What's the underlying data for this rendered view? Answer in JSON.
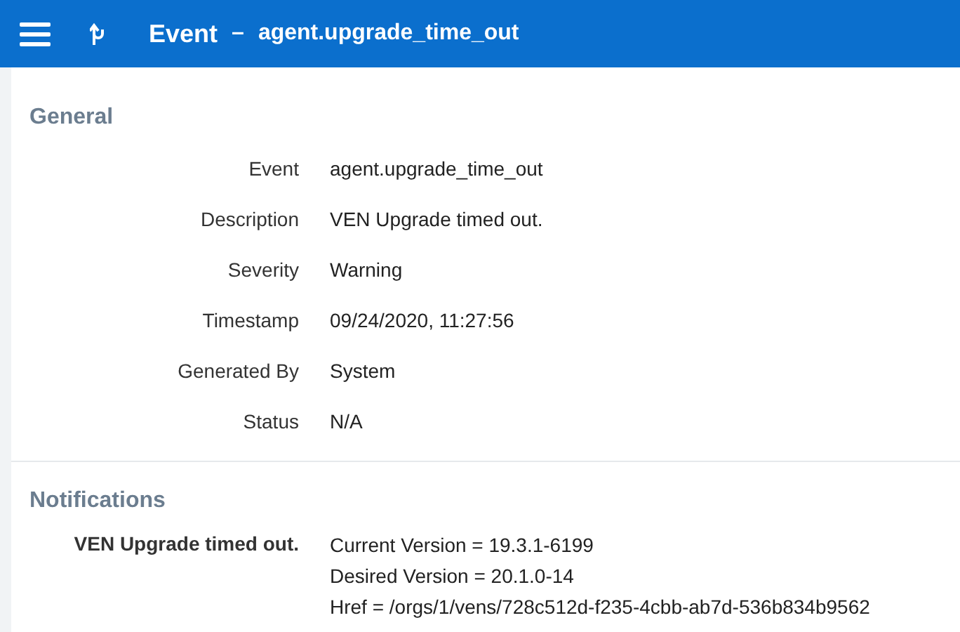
{
  "header": {
    "title": "Event",
    "separator": "–",
    "subtitle": "agent.upgrade_time_out"
  },
  "general": {
    "heading": "General",
    "fields": [
      {
        "label": "Event",
        "value": "agent.upgrade_time_out"
      },
      {
        "label": "Description",
        "value": "VEN Upgrade timed out."
      },
      {
        "label": "Severity",
        "value": "Warning"
      },
      {
        "label": "Timestamp",
        "value": "09/24/2020, 11:27:56"
      },
      {
        "label": "Generated By",
        "value": "System"
      },
      {
        "label": "Status",
        "value": "N/A"
      }
    ]
  },
  "notifications": {
    "heading": "Notifications",
    "items": [
      {
        "label": "VEN Upgrade timed out.",
        "lines": [
          "Current Version = 19.3.1-6199",
          "Desired Version = 20.1.0-14",
          "Href = /orgs/1/vens/728c512d-f235-4cbb-ab7d-536b834b9562"
        ]
      }
    ]
  }
}
